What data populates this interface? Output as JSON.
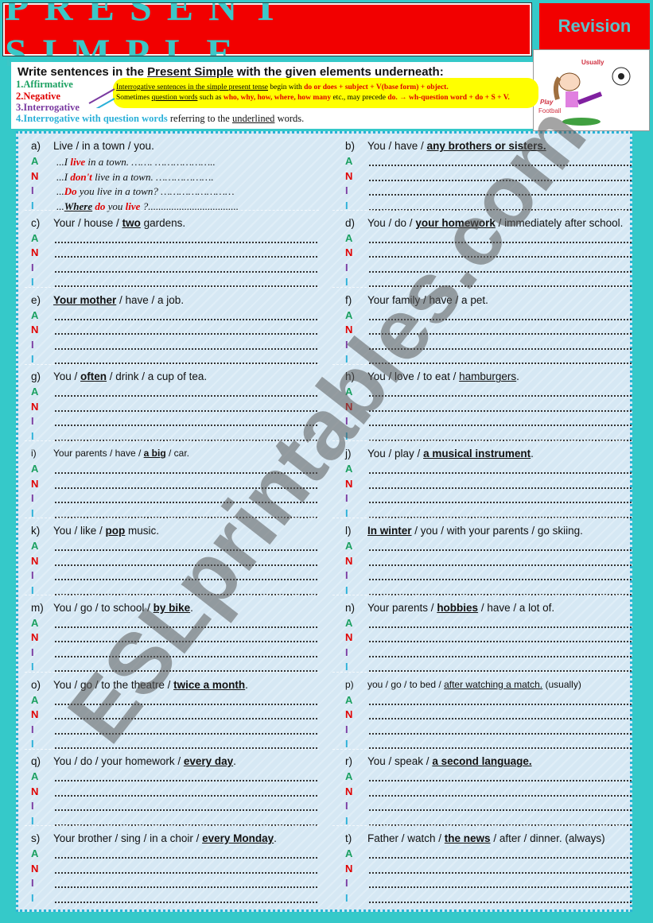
{
  "header": {
    "title": "PRESENT SIMPLE",
    "badge": "Revision",
    "picture_labels": [
      "Usually",
      "Play",
      "Football"
    ]
  },
  "instructions": {
    "pre": "Write sentences in the ",
    "key": "Present Simple",
    "post": " with the given elements underneath:",
    "levels": [
      {
        "label": "1.Affirmative",
        "color": "#1aa060"
      },
      {
        "label": "2.Negative",
        "color": "#e00000"
      },
      {
        "label": "3.Interrogative",
        "color": "#7a3aa0"
      },
      {
        "label": "4.Interrogative with question words",
        "color": "#2ab0d8",
        "suffix1": " referring to the ",
        "suffix_u": "underlined",
        "suffix2": " words."
      }
    ],
    "note1_u": "Interrogative sentences in the simple present tense",
    "note1_b": " begin with ",
    "note1_r": "do or does + subject + V(base form) + object.",
    "note2_a": "Sometimes ",
    "note2_u": "question words",
    "note2_b": " such as ",
    "note2_r": "who, why, how, where, how many",
    "note2_c": " etc., may precede ",
    "note2_r2": "do.  → wh-question word + do + S + V."
  },
  "letters": [
    {
      "l": "A",
      "c": "#1aa060"
    },
    {
      "l": "N",
      "c": "#e00000"
    },
    {
      "l": "I",
      "c": "#7a3aa0"
    },
    {
      "l": "I",
      "c": "#2ab0d8"
    }
  ],
  "example": [
    [
      [
        "...I ",
        ""
      ],
      [
        "live",
        "r"
      ],
      [
        " in a town. ……. ………………..",
        ""
      ]
    ],
    [
      [
        "...I ",
        ""
      ],
      [
        "don't",
        "r"
      ],
      [
        " live in a town. ……………….",
        ""
      ]
    ],
    [
      [
        "...",
        ""
      ],
      [
        "Do",
        "r"
      ],
      [
        " you live in a town? ……………………",
        ""
      ]
    ],
    [
      [
        "...",
        ""
      ],
      [
        "Where",
        "u"
      ],
      [
        " ",
        ""
      ],
      [
        "do",
        "r"
      ],
      [
        " you ",
        ""
      ],
      [
        "live",
        "r"
      ],
      [
        " ?...................................",
        ""
      ]
    ]
  ],
  "items": [
    {
      "id": "a)",
      "p": [
        [
          "Live / in a town / you.",
          ""
        ]
      ]
    },
    {
      "id": "b)",
      "p": [
        [
          "You / have / ",
          ""
        ],
        [
          "any brothers or sisters.",
          "bu"
        ]
      ]
    },
    {
      "id": "c)",
      "p": [
        [
          "Your / house / ",
          ""
        ],
        [
          "two",
          "bu"
        ],
        [
          " gardens.",
          ""
        ]
      ]
    },
    {
      "id": "d)",
      "p": [
        [
          "You / do / ",
          ""
        ],
        [
          "your homework",
          "bu"
        ],
        [
          " / immediately after school.",
          ""
        ]
      ]
    },
    {
      "id": "e)",
      "p": [
        [
          "Your mother",
          "bu"
        ],
        [
          " / have / a job.",
          ""
        ]
      ]
    },
    {
      "id": "f)",
      "p": [
        [
          "Your family / have / a pet.",
          ""
        ]
      ]
    },
    {
      "id": "g)",
      "p": [
        [
          "You / ",
          ""
        ],
        [
          "often",
          "bu"
        ],
        [
          " / drink / a cup of tea.",
          ""
        ]
      ]
    },
    {
      "id": "h)",
      "p": [
        [
          "You / love / to eat / ",
          ""
        ],
        [
          "hamburgers",
          "u"
        ],
        [
          ".",
          ""
        ]
      ]
    },
    {
      "id": "i)",
      "p": [
        [
          "Your parents / have / ",
          ""
        ],
        [
          "a big",
          "bu"
        ],
        [
          " / car.",
          ""
        ]
      ],
      "small": true
    },
    {
      "id": "j)",
      "p": [
        [
          "You / play / ",
          ""
        ],
        [
          "a musical instrument",
          "bu"
        ],
        [
          ".",
          ""
        ]
      ]
    },
    {
      "id": "k)",
      "p": [
        [
          "You / like / ",
          ""
        ],
        [
          "pop",
          "bu"
        ],
        [
          " music.",
          ""
        ]
      ]
    },
    {
      "id": "l)",
      "p": [
        [
          "In winter",
          "bu"
        ],
        [
          " / you / with your parents / go skiing.",
          ""
        ]
      ]
    },
    {
      "id": "m)",
      "p": [
        [
          "You / go / to school / ",
          ""
        ],
        [
          "by bike",
          "bu"
        ],
        [
          ".",
          ""
        ]
      ]
    },
    {
      "id": "n)",
      "p": [
        [
          "Your parents / ",
          ""
        ],
        [
          "hobbies",
          "bu"
        ],
        [
          " / have / a lot of.",
          ""
        ]
      ]
    },
    {
      "id": "o)",
      "p": [
        [
          "You / go / to the theatre / ",
          ""
        ],
        [
          "twice a month",
          "bu"
        ],
        [
          ".",
          ""
        ]
      ]
    },
    {
      "id": "p)",
      "p": [
        [
          "you / go / to bed / ",
          ""
        ],
        [
          "after watching a match.",
          "u"
        ],
        [
          " (usually)",
          ""
        ]
      ],
      "small": true
    },
    {
      "id": "q)",
      "p": [
        [
          "You / do / your homework / ",
          ""
        ],
        [
          "every day",
          "bu"
        ],
        [
          ".",
          ""
        ]
      ]
    },
    {
      "id": "r)",
      "p": [
        [
          "You / speak / ",
          ""
        ],
        [
          "a second language.",
          "bu"
        ]
      ]
    },
    {
      "id": "s)",
      "p": [
        [
          "Your brother / sing / in a choir / ",
          ""
        ],
        [
          "every Monday",
          "bu"
        ],
        [
          ".",
          ""
        ]
      ]
    },
    {
      "id": "t)",
      "p": [
        [
          "Father / watch / ",
          ""
        ],
        [
          "the news",
          "bu"
        ],
        [
          " / after / dinner. (always)",
          ""
        ]
      ]
    }
  ],
  "watermark": "ESLprintables.com"
}
